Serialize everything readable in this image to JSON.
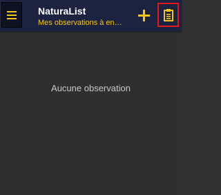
{
  "app": {
    "title": "NaturaList",
    "subtitle": "Mes observations à envoyer"
  },
  "toolbar": {
    "menu_icon": "hamburger-menu-icon",
    "add_icon": "plus-icon",
    "clipboard_icon": "clipboard-icon"
  },
  "main": {
    "empty_message": "Aucune observation"
  },
  "colors": {
    "toolbar_bg": "#1b2340",
    "accent": "#f5c518",
    "body_bg": "#2f2f2f",
    "highlight": "#e01818"
  }
}
